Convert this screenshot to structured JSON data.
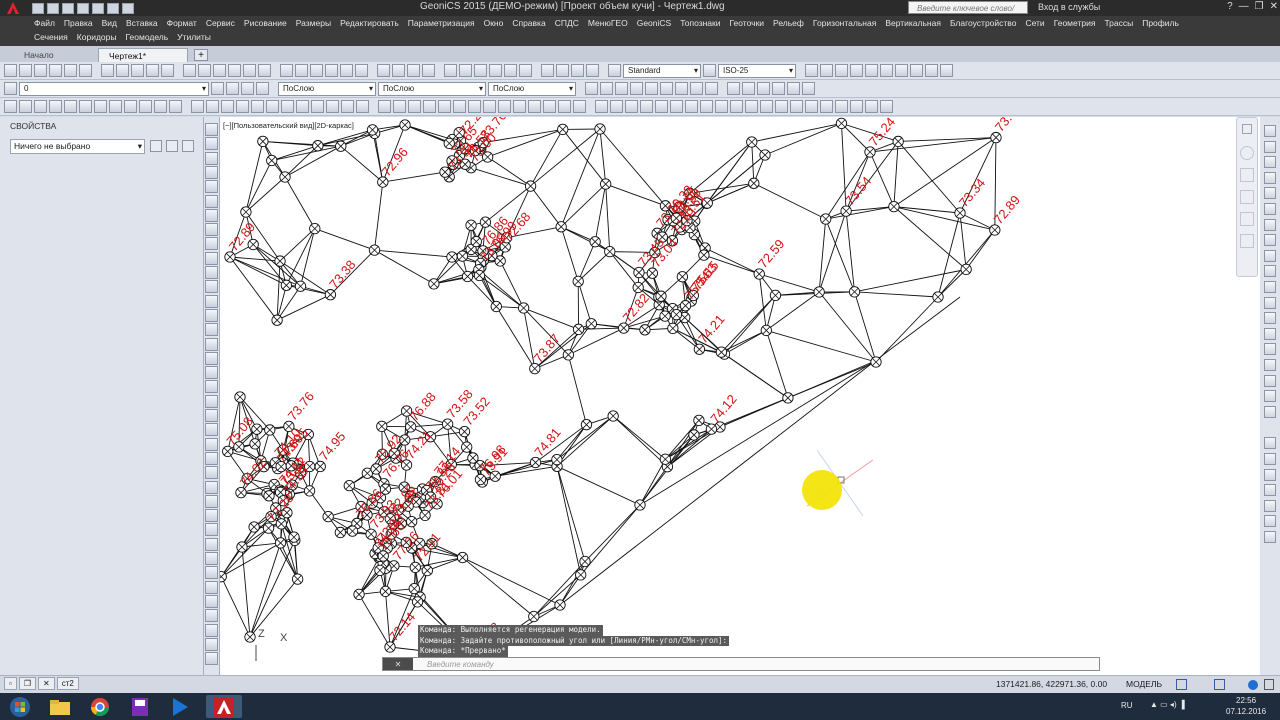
{
  "title_bar": {
    "title": "GeoniCS 2015 (ДЕМО-режим) [Проект объем кучи] - Чертеж1.dwg",
    "search_placeholder": "Введите ключевое слово/фразу",
    "login_label": "Вход в службы",
    "help_label": "?"
  },
  "menu": {
    "row1": [
      "Файл",
      "Правка",
      "Вид",
      "Вставка",
      "Формат",
      "Сервис",
      "Рисование",
      "Размеры",
      "Редактировать",
      "Параметризация",
      "Окно",
      "Справка",
      "СПДС",
      "МенюГЕО",
      "GeoniCS",
      "Топознаки",
      "Геоточки",
      "Рельеф",
      "Горизонтальная",
      "Вертикальная",
      "Благоустройство",
      "Сети",
      "Геометрия",
      "Трассы",
      "Профиль"
    ],
    "row2": [
      "Сечения",
      "Коридоры",
      "Геомодель",
      "Утилиты"
    ]
  },
  "tabs": {
    "start": "Начало",
    "drawing": "Чертеж1*",
    "add": "+"
  },
  "toolbars": {
    "text_style": "Standard",
    "dim_style": "ISO-25",
    "layer": "0",
    "color": "ПоСлою",
    "linetype": "ПоСлою",
    "lineweight": "ПоСлою"
  },
  "properties": {
    "title": "СВОЙСТВА",
    "selection": "Ничего не выбрано"
  },
  "viewport": {
    "label": "[−][Пользовательский вид][2D-каркас]"
  },
  "elevations": [
    "72.89",
    "73.34",
    "72.14",
    "72.29",
    "73.00",
    "73.65",
    "73.09",
    "72.68",
    "72.81",
    "73.10",
    "73.05",
    "73.45",
    "73.04",
    "73.95",
    "74.10",
    "73.76",
    "73.28",
    "73.62",
    "74.39",
    "73.58",
    "72.33",
    "73.91",
    "73.52",
    "73.81",
    "74.21",
    "75.28",
    "73.08",
    "72.91",
    "72.96",
    "72.93",
    "73.38",
    "73.54",
    "72.92",
    "72.89",
    "72.59",
    "72.82",
    "72.96",
    "73.87",
    "73.61",
    "74.12",
    "74.21",
    "74.81",
    "75.24",
    "74.48",
    "73.94",
    "73.76",
    "76.58",
    "76.99",
    "76.86",
    "76.33",
    "76.59",
    "75.51",
    "75.63",
    "75.74",
    "75.15",
    "74.60",
    "74.02",
    "74.11",
    "74.95",
    "75.08",
    "76.01",
    "76.76",
    "76.86",
    "76.88",
    "76.98",
    "77.14",
    "77.26",
    "75.60",
    "74.34",
    "73.93"
  ],
  "command": {
    "history": [
      "Команда:  Выполняется регенерация модели.",
      "Команда: Задайте противоположный угол или [Линия/РМн-угол/СМн-угол]:",
      "Команда: *Прервано*"
    ],
    "placeholder": "Введите команду",
    "close": "✕"
  },
  "status": {
    "coords": "1371421.86, 422971.36, 0.00",
    "model": "МОДЕЛЬ",
    "layout_tab": "ст2"
  },
  "taskbar": {
    "lang": "RU",
    "time": "22:56",
    "date": "07.12.2016"
  },
  "colors": {
    "label_red": "#d21414",
    "cursor_yellow": "#f2e40a",
    "menubar": "#3a3a3a",
    "taskbar": "#1e2c3d"
  }
}
